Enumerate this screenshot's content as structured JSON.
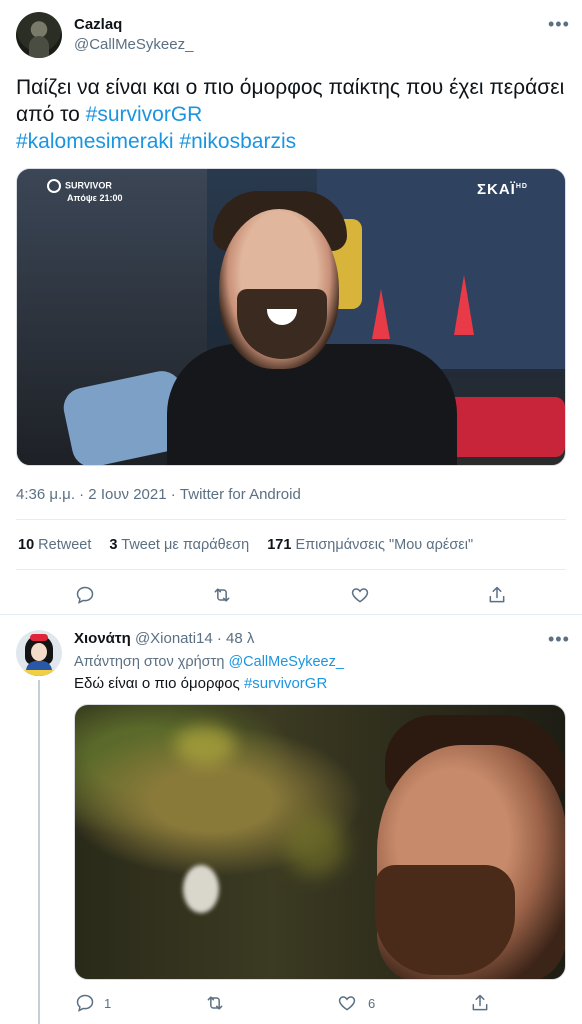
{
  "main_tweet": {
    "display_name": "Cazlaq",
    "handle": "@CallMeSykeez_",
    "text_plain": "Παίζει να είναι και ο πιο όμορφος παίκτης που έχει περάσει από το ",
    "hashtag1": "#survivorGR",
    "hashtag2": "#kalomesimeraki",
    "hashtag3": "#nikosbarzis",
    "media_logo_line1": "SURVIVOR",
    "media_logo_line2": "Απόψε 21:00",
    "media_channel": "ΣΚΑΪ",
    "media_channel_hd": "HD",
    "timestamp": "4:36 μ.μ. · 2 Ιουν 2021 · Twitter for Android",
    "stats": {
      "retweets_count": "10",
      "retweets_label": "Retweet",
      "quotes_count": "3",
      "quotes_label": "Tweet με παράθεση",
      "likes_count": "171",
      "likes_label": "Επισημάνσεις \"Μου αρέσει\""
    },
    "actions": [
      "reply-icon",
      "retweet-icon",
      "like-icon",
      "share-icon"
    ]
  },
  "reply_tweet": {
    "display_name": "Χιονάτη",
    "handle": "@Xionati14",
    "time": "· 48 λ",
    "reply_prefix": "Απάντηση στον χρήστη",
    "reply_to": "@CallMeSykeez_",
    "text_plain": "Εδώ είναι ο πιο όμορφος ",
    "hashtag": "#survivorGR",
    "reply_count": "1",
    "like_count": "6"
  },
  "colors": {
    "link": "#1b95e0",
    "muted": "#5b7083",
    "text": "#0f1419",
    "divider": "#e6ecf0"
  }
}
